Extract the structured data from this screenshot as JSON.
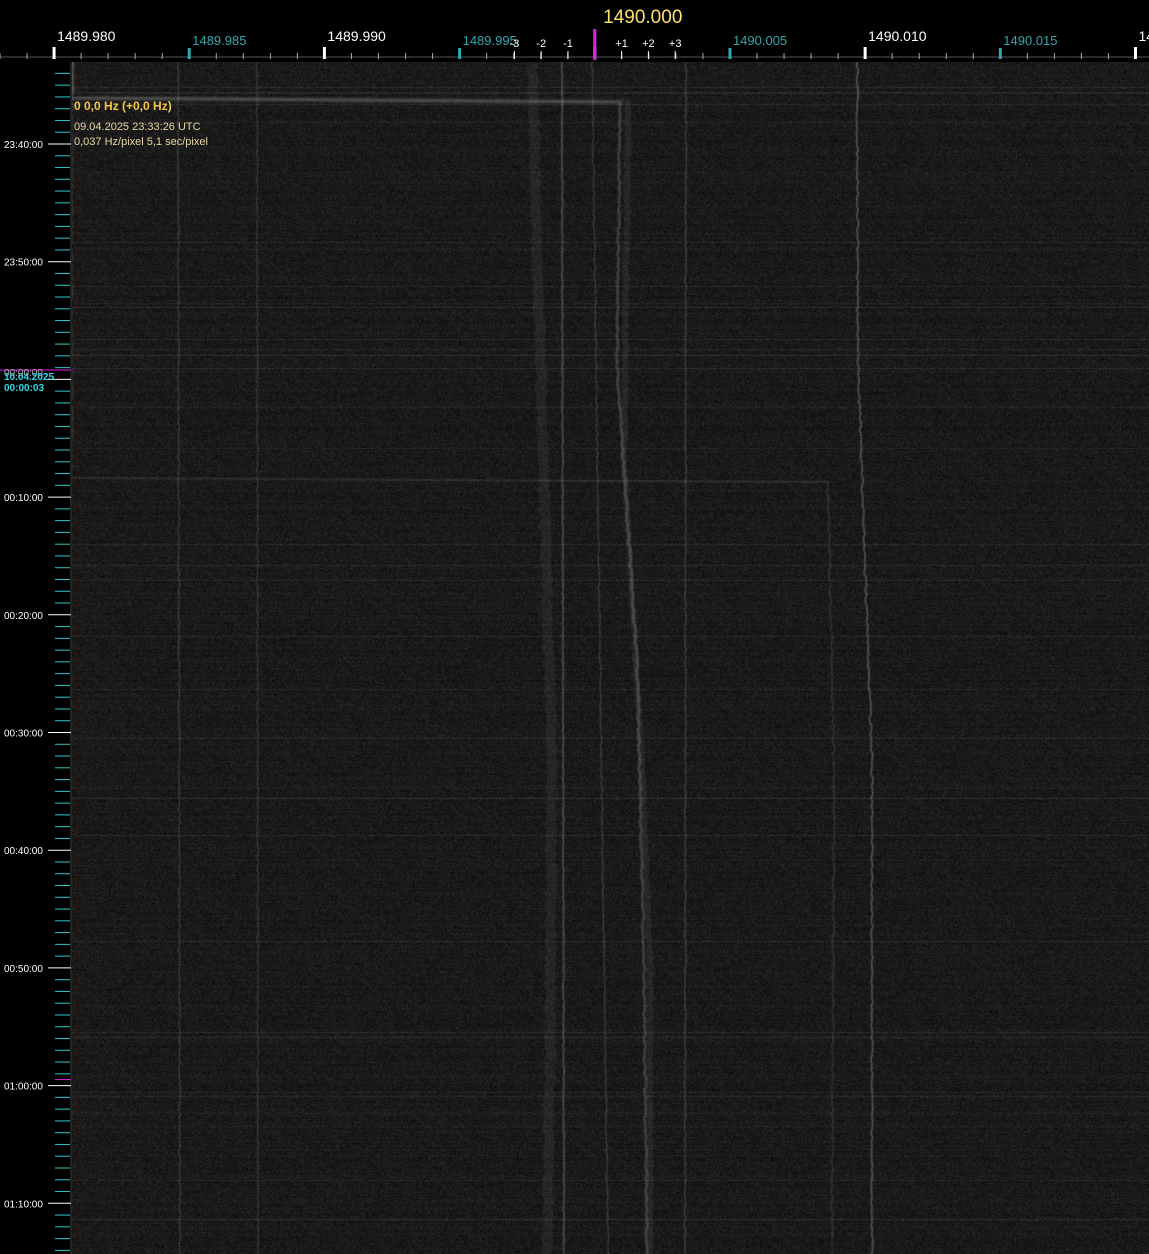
{
  "colors": {
    "background": "#000000",
    "waterfall_bg": "#1a1a1a",
    "major_freq_label": "#ffffff",
    "minor_freq_label": "#2fa8b0",
    "center_freq_label": "#ffe066",
    "center_marker": "#e020e0",
    "offset_label": "#ffffff",
    "time_label": "#ffffff",
    "time_minor_tick": "#28c8c8",
    "date_change_label": "#30d8e8",
    "info_text": "#f5c842",
    "info_sub": "#e8d8a0"
  },
  "freq_axis": {
    "center_label": "1490.000",
    "major_labels": [
      {
        "freq": 1489.98,
        "text": "1489.980"
      },
      {
        "freq": 1489.99,
        "text": "1489.990"
      },
      {
        "freq": 1490.01,
        "text": "1490.010"
      },
      {
        "freq": 1490.02,
        "text": "14"
      }
    ],
    "minor_labels": [
      {
        "freq": 1489.985,
        "text": "1489.985"
      },
      {
        "freq": 1489.995,
        "text": "1489.995"
      },
      {
        "freq": 1490.005,
        "text": "1490.005"
      },
      {
        "freq": 1490.015,
        "text": "1490.015"
      }
    ],
    "offset_labels": [
      {
        "offset": -3,
        "text": "-3"
      },
      {
        "offset": -2,
        "text": "-2"
      },
      {
        "offset": -1,
        "text": "-1"
      },
      {
        "offset": 1,
        "text": "+1"
      },
      {
        "offset": 2,
        "text": "+2"
      },
      {
        "offset": 3,
        "text": "+3"
      }
    ],
    "min_freq": 1489.978,
    "max_freq": 1490.0205
  },
  "time_axis": {
    "labels": [
      {
        "minutes": 0,
        "text": "23:40:00"
      },
      {
        "minutes": 10,
        "text": "23:50:00"
      },
      {
        "minutes": 30,
        "text": "00:10:00"
      },
      {
        "minutes": 40,
        "text": "00:20:00"
      },
      {
        "minutes": 50,
        "text": "00:30:00"
      },
      {
        "minutes": 60,
        "text": "00:40:00"
      },
      {
        "minutes": 70,
        "text": "00:50:00"
      },
      {
        "minutes": 80,
        "text": "01:00:00"
      },
      {
        "minutes": 90,
        "text": "01:10:00"
      }
    ],
    "overlapped_label": "00:00:00",
    "date_change": {
      "date": "10.04.2025",
      "time": "00:00:03",
      "minutes": 20.05
    }
  },
  "info": {
    "marker_line": "0 0,0 Hz (+0,0 Hz)",
    "datetime": "09.04.2025 23:33:26 UTC",
    "resolution": "0,037 Hz/pixel 5,1 sec/pixel"
  }
}
